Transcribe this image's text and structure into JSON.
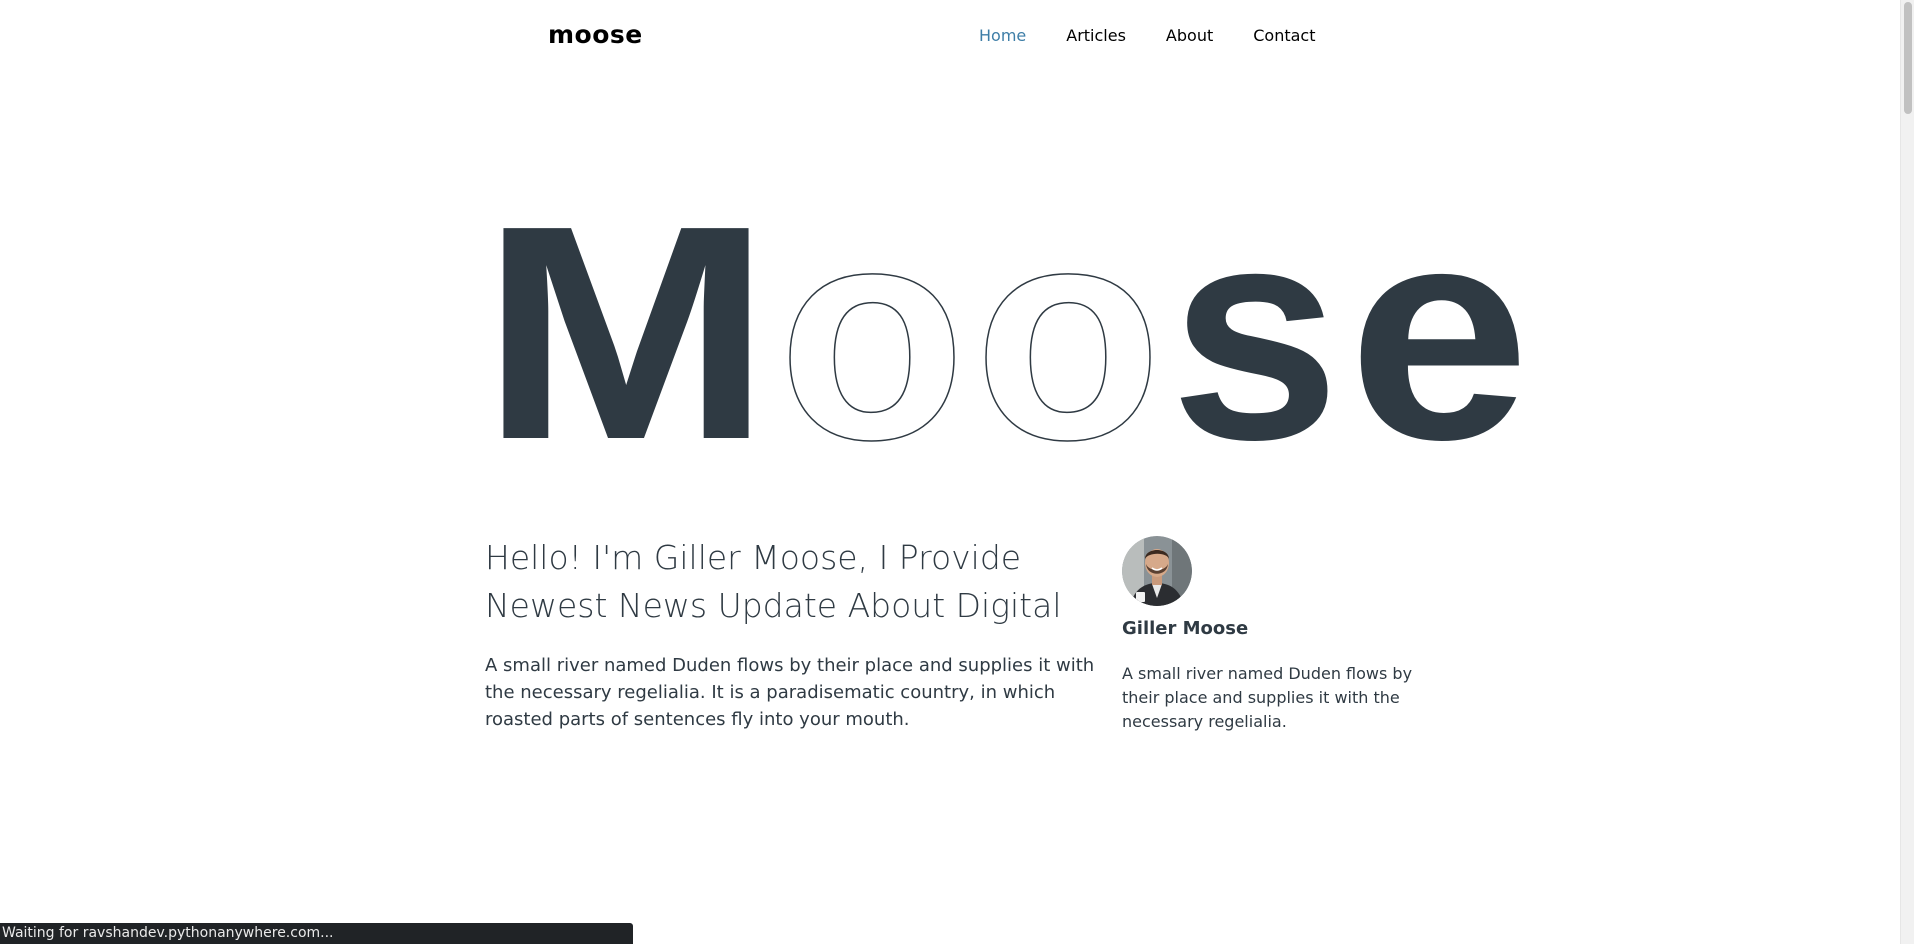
{
  "header": {
    "logo": "moose",
    "nav": {
      "home": "Home",
      "articles": "Articles",
      "about": "About",
      "contact": "Contact"
    }
  },
  "hero": {
    "title_letters": {
      "m": "M",
      "o1": "o",
      "o2": "o",
      "s": "s",
      "e": "e"
    },
    "word": "Moose"
  },
  "intro": {
    "headline": "Hello! I'm Giller Moose, I Provide Newest News Update About Digital",
    "text": "A small river named Duden flows by their place and supplies it with the necessary regelialia. It is a paradisematic country, in which roasted parts of sentences fly into your mouth."
  },
  "author": {
    "name": "Giller Moose",
    "bio": "A small river named Duden flows by their place and supplies it with the necessary regelialia."
  },
  "status_bar": {
    "text": "Waiting for ravshandev.pythonanywhere.com..."
  },
  "colors": {
    "dark": "#2f3a43",
    "nav_active": "#3e7ea7"
  }
}
